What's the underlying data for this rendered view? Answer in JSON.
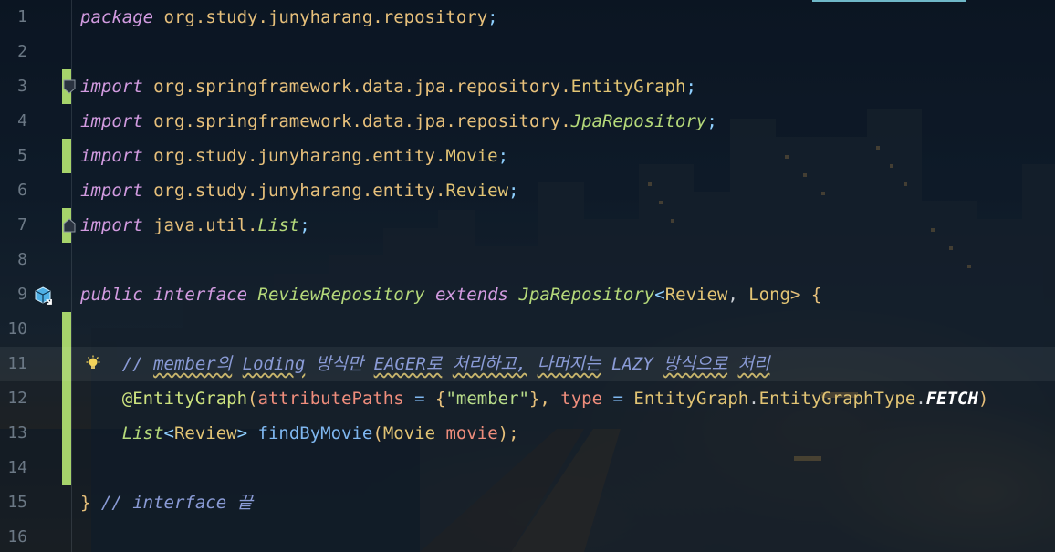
{
  "editor": {
    "language": "java",
    "lines": [
      {
        "n": "1",
        "tokens": [
          {
            "t": "package",
            "c": "kw"
          },
          {
            "t": " ",
            "c": "muted"
          },
          {
            "t": "org.study.junyharang.repository",
            "c": "pk"
          },
          {
            "t": ";",
            "c": "punct"
          }
        ]
      },
      {
        "n": "2",
        "tokens": []
      },
      {
        "n": "3",
        "tokens": [
          {
            "t": "import",
            "c": "kw"
          },
          {
            "t": " ",
            "c": "muted"
          },
          {
            "t": "org.springframework.data.jpa.repository.",
            "c": "pk"
          },
          {
            "t": "EntityGraph",
            "c": "cls"
          },
          {
            "t": ";",
            "c": "punct"
          }
        ]
      },
      {
        "n": "4",
        "tokens": [
          {
            "t": "import",
            "c": "kw"
          },
          {
            "t": " ",
            "c": "muted"
          },
          {
            "t": "org.springframework.data.jpa.repository.",
            "c": "pk"
          },
          {
            "t": "JpaRepository",
            "c": "ital-cls"
          },
          {
            "t": ";",
            "c": "punct"
          }
        ]
      },
      {
        "n": "5",
        "tokens": [
          {
            "t": "import",
            "c": "kw"
          },
          {
            "t": " ",
            "c": "muted"
          },
          {
            "t": "org.study.junyharang.entity.",
            "c": "pk"
          },
          {
            "t": "Movie",
            "c": "cls"
          },
          {
            "t": ";",
            "c": "punct"
          }
        ]
      },
      {
        "n": "6",
        "tokens": [
          {
            "t": "import",
            "c": "kw"
          },
          {
            "t": " ",
            "c": "muted"
          },
          {
            "t": "org.study.junyharang.entity.",
            "c": "pk"
          },
          {
            "t": "Review",
            "c": "cls"
          },
          {
            "t": ";",
            "c": "punct"
          }
        ]
      },
      {
        "n": "7",
        "tokens": [
          {
            "t": "import",
            "c": "kw"
          },
          {
            "t": " ",
            "c": "muted"
          },
          {
            "t": "java.util.",
            "c": "pk"
          },
          {
            "t": "List",
            "c": "ital-cls"
          },
          {
            "t": ";",
            "c": "punct"
          }
        ]
      },
      {
        "n": "8",
        "tokens": []
      },
      {
        "n": "9",
        "tokens": [
          {
            "t": "public",
            "c": "kw"
          },
          {
            "t": " ",
            "c": "muted"
          },
          {
            "t": "interface",
            "c": "kw"
          },
          {
            "t": " ",
            "c": "muted"
          },
          {
            "t": "ReviewRepository",
            "c": "ital-cls"
          },
          {
            "t": " ",
            "c": "muted"
          },
          {
            "t": "extends",
            "c": "kw"
          },
          {
            "t": " ",
            "c": "muted"
          },
          {
            "t": "JpaRepository",
            "c": "ital-cls"
          },
          {
            "t": "<",
            "c": "punct"
          },
          {
            "t": "Review",
            "c": "cls"
          },
          {
            "t": ", ",
            "c": "muted"
          },
          {
            "t": "Long",
            "c": "cls"
          },
          {
            "t": "> {",
            "c": "pk"
          }
        ]
      },
      {
        "n": "10",
        "tokens": []
      },
      {
        "n": "11",
        "tokens": [
          {
            "t": "    ",
            "c": "muted"
          },
          {
            "t": "// ",
            "c": "cmt"
          },
          {
            "t": "member의",
            "c": "cmt squig"
          },
          {
            "t": " ",
            "c": "cmt"
          },
          {
            "t": "Loding",
            "c": "cmt squig"
          },
          {
            "t": " 방식만 ",
            "c": "cmt"
          },
          {
            "t": "EAGER로",
            "c": "cmt squig"
          },
          {
            "t": " ",
            "c": "cmt"
          },
          {
            "t": "처리하고,",
            "c": "cmt squig"
          },
          {
            "t": " ",
            "c": "cmt"
          },
          {
            "t": "나머지는",
            "c": "cmt squig"
          },
          {
            "t": " LAZY ",
            "c": "cmt"
          },
          {
            "t": "방식으로",
            "c": "cmt squig"
          },
          {
            "t": " ",
            "c": "cmt"
          },
          {
            "t": "처리",
            "c": "cmt squig"
          }
        ]
      },
      {
        "n": "12",
        "tokens": [
          {
            "t": "    ",
            "c": "muted"
          },
          {
            "t": "@EntityGraph",
            "c": "ann"
          },
          {
            "t": "(",
            "c": "pk"
          },
          {
            "t": "attributePaths",
            "c": "param"
          },
          {
            "t": " = ",
            "c": "fn"
          },
          {
            "t": "{",
            "c": "pk"
          },
          {
            "t": "\"member\"",
            "c": "str"
          },
          {
            "t": "}, ",
            "c": "pk"
          },
          {
            "t": "type",
            "c": "param"
          },
          {
            "t": " = ",
            "c": "fn"
          },
          {
            "t": "EntityGraph",
            "c": "cls"
          },
          {
            "t": ".",
            "c": "muted"
          },
          {
            "t": "EntityGraphType",
            "c": "cls"
          },
          {
            "t": ".",
            "c": "muted"
          },
          {
            "t": "FETCH",
            "c": "bold-white"
          },
          {
            "t": ")",
            "c": "pk"
          }
        ]
      },
      {
        "n": "13",
        "tokens": [
          {
            "t": "    ",
            "c": "muted"
          },
          {
            "t": "List",
            "c": "ret-cls"
          },
          {
            "t": "<",
            "c": "punct"
          },
          {
            "t": "Review",
            "c": "cls"
          },
          {
            "t": "> ",
            "c": "punct"
          },
          {
            "t": "findByMovie",
            "c": "fn"
          },
          {
            "t": "(",
            "c": "pk"
          },
          {
            "t": "Movie",
            "c": "cls"
          },
          {
            "t": " ",
            "c": "muted"
          },
          {
            "t": "movie",
            "c": "param"
          },
          {
            "t": ");",
            "c": "pk"
          }
        ]
      },
      {
        "n": "14",
        "tokens": []
      },
      {
        "n": "15",
        "tokens": [
          {
            "t": "}",
            "c": "pk"
          },
          {
            "t": " // ",
            "c": "cmt"
          },
          {
            "t": "interface",
            "c": "cmt"
          },
          {
            "t": " 끝",
            "c": "cmt"
          }
        ]
      },
      {
        "n": "16",
        "tokens": []
      }
    ],
    "current_line": "11",
    "icons": {
      "fold_marker": "fold-marker-icon",
      "implemented_by": "implemented-interface-icon",
      "intention": "lightbulb-icon"
    }
  }
}
